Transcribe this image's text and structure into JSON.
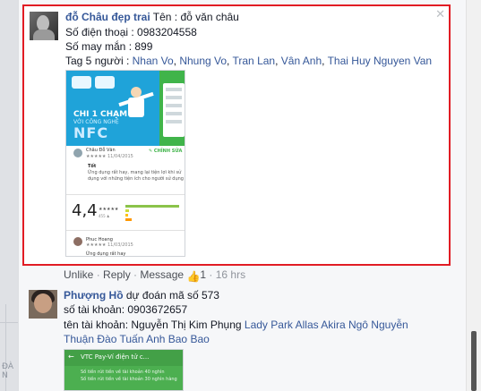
{
  "comment1": {
    "author": "đỗ Châu đẹp trai",
    "line1_rest": " Tên : đỗ văn châu",
    "phone": "Số điện thoại : 0983204558",
    "lucky": "Số may mắn : 899",
    "tag_prefix": "Tag 5 người : ",
    "tags": [
      "Nhan Vo",
      "Nhung Vo",
      "Tran Lan",
      "Vân Anh",
      "Thai Huy Nguyen Van"
    ],
    "close_glyph": "✕",
    "screenshot": {
      "banner_t1": "CHI 1 CHẠM",
      "banner_t2": "VỚI CÔNG NGHỆ",
      "banner_t3": "NFC",
      "reviewer": "Châu Đỗ Văn",
      "review_date": "★★★★★ 11/04/2015",
      "edit_label": "✎ CHỈNH SỬA",
      "review_title": "Tốt",
      "review_t1": "Ứng dụng rất hay, mang lại tiện lợi khi sử",
      "review_t2": "dụng với những tiện ích cho người sử dụng",
      "rating": "4,4",
      "rating_stars": "★★★★★",
      "rating_count": "455 ♟",
      "reviewer2": "Phuc Hoang",
      "review2_date": "★★★★★ 11/03/2015",
      "review2_text": "Ứng dụng rất hay"
    }
  },
  "actions": {
    "unlike": "Unlike",
    "reply": "Reply",
    "message": "Message",
    "sep": " · ",
    "like_count": "1",
    "time": "16 hrs"
  },
  "comment2": {
    "author": "Phượng Hồ",
    "line1_rest": " dự đoán mã số 573",
    "account_no": "số tài khoản: 0903672657",
    "account_name_prefix": "tên tài khoản: Nguyễn Thị Kim Phụng ",
    "tags_line1": "Lady Park Allas Akira Ngô Nguyễn",
    "tags_line2": "Thuận Đào Tuấn Anh Bao Bao",
    "screenshot": {
      "back": "←",
      "title": "VTC Pay-Ví điện tử c...",
      "tx1": "Số tiền rút tiền về tài khoản 40 nghìn",
      "tx2": "Số tiền rút tiền về tài khoản 30 nghìn hàng"
    }
  },
  "map_text": "ĐÀ N"
}
